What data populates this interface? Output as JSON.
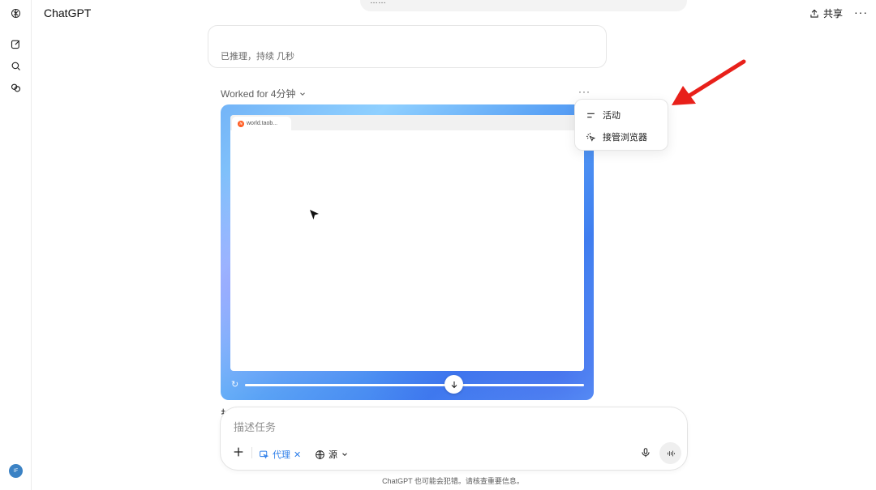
{
  "header": {
    "brand": "ChatGPT",
    "share_label": "共享"
  },
  "previous_message": {
    "text": "……"
  },
  "reasoning": {
    "text": "已推理，持续 几秒"
  },
  "worked": {
    "label": "Worked for 4分钟"
  },
  "browser": {
    "tab_title": "world.taob...",
    "favicon_text": "淘",
    "progress_fraction": 1.0
  },
  "menu": {
    "items": [
      {
        "label": "活动",
        "icon": "lines-icon"
      },
      {
        "label": "接管浏览器",
        "icon": "click-cursor-icon"
      }
    ]
  },
  "peek_text": "扌",
  "composer": {
    "placeholder": "描述任务",
    "agent_label": "代理",
    "source_label": "源"
  },
  "footer": {
    "text": "ChatGPT 也可能会犯错。请核查重要信息。"
  },
  "user": {
    "avatar_initials": "IF"
  },
  "colors": {
    "accent": "#2b7de9",
    "annotation_arrow": "#e8201a"
  }
}
